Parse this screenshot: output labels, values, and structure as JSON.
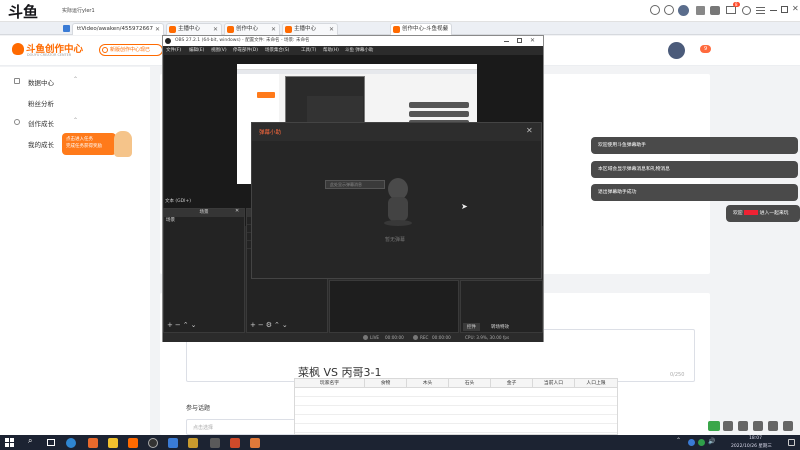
{
  "browser": {
    "logo_text": "斗鱼",
    "top_caption": "实际运行yler1",
    "address": "ttVideo/awaken/455972667",
    "tabs": [
      {
        "label": "主播中心",
        "color": "#ff6a00"
      },
      {
        "label": "创作中心",
        "color": "#ff6a00"
      },
      {
        "label": "主播中心",
        "color": "#ff6a00"
      },
      {
        "label": "创作中心-斗鱼视频",
        "color": "#ff6a00"
      }
    ],
    "badge_count": "8"
  },
  "site": {
    "brand": "斗鱼创作中心",
    "brand_sub": "DOUYU CREATOR CENTER",
    "new_feature_btn": "新版创作中心现已",
    "notif_count": "9"
  },
  "sidebar": {
    "items": [
      {
        "label": "数据中心",
        "icon": "chart-icon"
      },
      {
        "label": "粉丝分析"
      },
      {
        "label": "创作成长",
        "icon": "up-icon"
      },
      {
        "label": "我的成长"
      }
    ],
    "mascot_tip_line1": "点击进入任务",
    "mascot_tip_line2": "完成任务获得奖励"
  },
  "obs": {
    "title": "OBS 27.2.1 (64-bit, windows) - 配置文件: 未命名 - 场景: 未命名",
    "menu": [
      "文件(F)",
      "编辑(E)",
      "视图(V)",
      "停靠部件(D)",
      "场景集合(S)",
      "工具(T)",
      "帮助(H)",
      "斗鱼 弹幕小助"
    ],
    "source_label": "文本 (GDI+)",
    "scenes_header": "场景",
    "scenes_sub": "场景",
    "sources_header": "来源",
    "tab_controls": "控件",
    "tab_transition": "转场特效",
    "status": {
      "live_label": "LIVE",
      "live_time": "00:00:00",
      "rec_label": "REC",
      "rec_time": "00:00:00",
      "cpu": "CPU: 3.9%, 30.00 fps"
    }
  },
  "danmaku": {
    "title": "弹幕小助",
    "empty_text": "暂无弹幕",
    "tooltip": "此处显示弹幕消息"
  },
  "chat": {
    "bubbles": [
      "欢迎使用斗鱼弹幕助手",
      "本区域会显示弹幕消息和礼物消息",
      "退出弹幕助手成功"
    ],
    "right_partial_prefix": "欢迎",
    "right_partial_suffix": "进入一起来玩"
  },
  "form": {
    "char_count": "0/250",
    "topic_label": "参与话题",
    "topic_placeholder": "点击选择"
  },
  "overlay_title": "菜枫 VS 丙哥3-1",
  "table": {
    "headers": [
      "玩家名字",
      "食物",
      "木头",
      "石头",
      "金子",
      "当前人口",
      "人口上限"
    ]
  },
  "taskbar": {
    "time": "18:07",
    "date": "2022/10/26 星期三"
  },
  "colors": {
    "accent": "#ff6a00",
    "chat_bubble": "#4a4a4a",
    "obs_bg": "#2b2b2b",
    "taskbar": "#1c2332"
  }
}
